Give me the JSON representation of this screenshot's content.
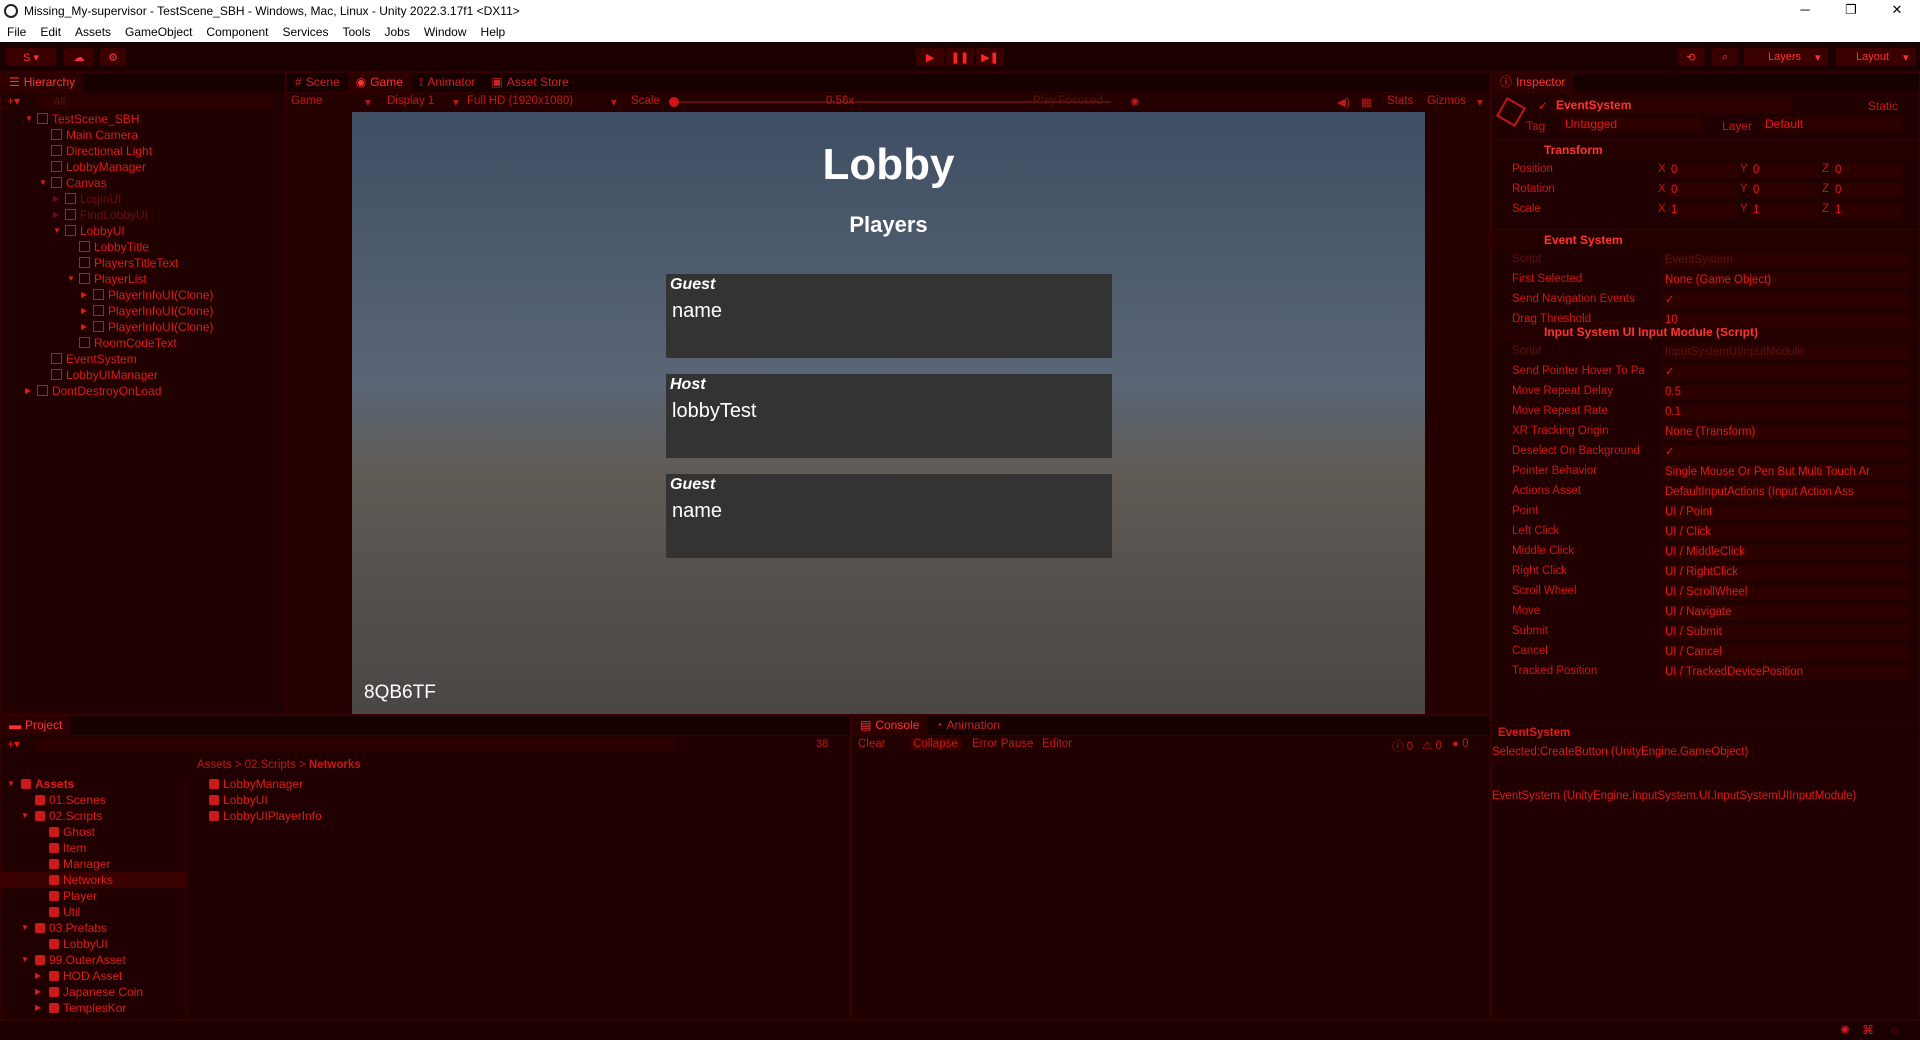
{
  "window": {
    "title": "Missing_My-supervisor - TestScene_SBH - Windows, Mac, Linux - Unity 2022.3.17f1 <DX11>",
    "controls": [
      "─",
      "❐",
      "✕"
    ]
  },
  "menu": [
    "File",
    "Edit",
    "Assets",
    "GameObject",
    "Component",
    "Services",
    "Tools",
    "Jobs",
    "Window",
    "Help"
  ],
  "toolbar": {
    "account_label": "S ▾",
    "layers_label": "Layers",
    "layout_label": "Layout"
  },
  "hierarchy": {
    "tab": "Hierarchy",
    "search_placeholder": "All",
    "items": [
      {
        "label": "TestScene_SBH",
        "indent": 0,
        "dim": false,
        "arrow": "▼"
      },
      {
        "label": "Main Camera",
        "indent": 1,
        "dim": false,
        "arrow": ""
      },
      {
        "label": "Directional Light",
        "indent": 1,
        "dim": false,
        "arrow": ""
      },
      {
        "label": "LobbyManager",
        "indent": 1,
        "dim": false,
        "arrow": ""
      },
      {
        "label": "Canvas",
        "indent": 1,
        "dim": false,
        "arrow": "▼"
      },
      {
        "label": "LoginUI",
        "indent": 2,
        "dim": true,
        "arrow": "▶"
      },
      {
        "label": "FindLobbyUI",
        "indent": 2,
        "dim": true,
        "arrow": "▶"
      },
      {
        "label": "LobbyUI",
        "indent": 2,
        "dim": false,
        "arrow": "▼"
      },
      {
        "label": "LobbyTitle",
        "indent": 3,
        "dim": false,
        "arrow": ""
      },
      {
        "label": "PlayersTitleText",
        "indent": 3,
        "dim": false,
        "arrow": ""
      },
      {
        "label": "PlayerList",
        "indent": 3,
        "dim": false,
        "arrow": "▼"
      },
      {
        "label": "PlayerInfoUI(Clone)",
        "indent": 4,
        "dim": false,
        "arrow": "▶"
      },
      {
        "label": "PlayerInfoUI(Clone)",
        "indent": 4,
        "dim": false,
        "arrow": "▶"
      },
      {
        "label": "PlayerInfoUI(Clone)",
        "indent": 4,
        "dim": false,
        "arrow": "▶"
      },
      {
        "label": "RoomCodeText",
        "indent": 3,
        "dim": false,
        "arrow": ""
      },
      {
        "label": "EventSystem",
        "indent": 1,
        "dim": false,
        "arrow": ""
      },
      {
        "label": "LobbyUIManager",
        "indent": 1,
        "dim": false,
        "arrow": ""
      },
      {
        "label": "DontDestroyOnLoad",
        "indent": 0,
        "dim": false,
        "arrow": "▶"
      }
    ]
  },
  "center_tabs": [
    "Scene",
    "Game",
    "Animator",
    "Asset Store"
  ],
  "game_toolbar": {
    "mode": "Game",
    "display": "Display 1",
    "resolution": "Full HD (1920x1080)",
    "scale_label": "Scale",
    "scale_value": "0.56x",
    "play_focused": "Play Focused",
    "stats": "Stats",
    "gizmos": "Gizmos"
  },
  "game": {
    "title": "Lobby",
    "subtitle": "Players",
    "players": [
      {
        "role": "Guest",
        "name": "name"
      },
      {
        "role": "Host",
        "name": "lobbyTest"
      },
      {
        "role": "Guest",
        "name": "name"
      }
    ],
    "room_code": "8QB6TF"
  },
  "inspector": {
    "tab": "Inspector",
    "object_name": "EventSystem",
    "static_label": "Static",
    "tag_label": "Tag",
    "tag_value": "Untagged",
    "layer_label": "Layer",
    "layer_value": "Default",
    "transform": {
      "header": "Transform",
      "rows": [
        {
          "label": "Position",
          "x": "0",
          "y": "0",
          "z": "0"
        },
        {
          "label": "Rotation",
          "x": "0",
          "y": "0",
          "z": "0"
        },
        {
          "label": "Scale",
          "x": "1",
          "y": "1",
          "z": "1"
        }
      ]
    },
    "event_system": {
      "header": "Event System",
      "rows": [
        {
          "label": "Script",
          "value": "EventSystem",
          "dim": true
        },
        {
          "label": "First Selected",
          "value": "None (Game Object)",
          "dim": false
        },
        {
          "label": "Send Navigation Events",
          "value": "✓",
          "dim": false
        },
        {
          "label": "Drag Threshold",
          "value": "10",
          "dim": false
        }
      ]
    },
    "input_module": {
      "header": "Input System UI Input Module (Script)",
      "rows": [
        {
          "label": "Script",
          "value": "InputSystemUIInputModule",
          "dim": true
        },
        {
          "label": "Send Pointer Hover To Pa",
          "value": "✓",
          "dim": false
        },
        {
          "label": "Move Repeat Delay",
          "value": "0.5",
          "dim": false
        },
        {
          "label": "Move Repeat Rate",
          "value": "0.1",
          "dim": false
        },
        {
          "label": "XR Tracking Origin",
          "value": "None (Transform)",
          "dim": false
        },
        {
          "label": "Deselect On Background",
          "value": "✓",
          "dim": false
        },
        {
          "label": "Pointer Behavior",
          "value": "Single Mouse Or Pen But Multi Touch Ar",
          "dim": false
        },
        {
          "label": "Actions Asset",
          "value": "DefaultInputActions (Input Action Ass",
          "dim": false
        },
        {
          "label": "Point",
          "value": "UI / Point",
          "dim": false
        },
        {
          "label": "Left Click",
          "value": "UI / Click",
          "dim": false
        },
        {
          "label": "Middle Click",
          "value": "UI / MiddleClick",
          "dim": false
        },
        {
          "label": "Right Click",
          "value": "UI / RightClick",
          "dim": false
        },
        {
          "label": "Scroll Wheel",
          "value": "UI / ScrollWheel",
          "dim": false
        },
        {
          "label": "Move",
          "value": "UI / Navigate",
          "dim": false
        },
        {
          "label": "Submit",
          "value": "UI / Submit",
          "dim": false
        },
        {
          "label": "Cancel",
          "value": "UI / Cancel",
          "dim": false
        },
        {
          "label": "Tracked Position",
          "value": "UI / TrackedDevicePosition",
          "dim": false
        }
      ]
    },
    "preview_label": "EventSystem"
  },
  "project": {
    "tab": "Project",
    "count": "38",
    "breadcrumb": [
      "Assets",
      "02.Scripts",
      "Networks"
    ],
    "tree": [
      {
        "label": "Assets",
        "indent": 0,
        "arrow": "▼",
        "bold": true
      },
      {
        "label": "01.Scenes",
        "indent": 1,
        "arrow": "",
        "bold": false
      },
      {
        "label": "02.Scripts",
        "indent": 1,
        "arrow": "▼",
        "bold": false
      },
      {
        "label": "Ghost",
        "indent": 2,
        "arrow": "",
        "bold": false
      },
      {
        "label": "Item",
        "indent": 2,
        "arrow": "",
        "bold": false
      },
      {
        "label": "Manager",
        "indent": 2,
        "arrow": "",
        "bold": false
      },
      {
        "label": "Networks",
        "indent": 2,
        "arrow": "",
        "bold": false
      },
      {
        "label": "Player",
        "indent": 2,
        "arrow": "",
        "bold": false
      },
      {
        "label": "Util",
        "indent": 2,
        "arrow": "",
        "bold": false
      },
      {
        "label": "03.Prefabs",
        "indent": 1,
        "arrow": "▼",
        "bold": false
      },
      {
        "label": "LobbyUI",
        "indent": 2,
        "arrow": "",
        "bold": false
      },
      {
        "label": "99.OuterAsset",
        "indent": 1,
        "arrow": "▼",
        "bold": false
      },
      {
        "label": "HOD Asset",
        "indent": 2,
        "arrow": "▶",
        "bold": false
      },
      {
        "label": "Japanese Coin",
        "indent": 2,
        "arrow": "▶",
        "bold": false
      },
      {
        "label": "TemplesKor",
        "indent": 2,
        "arrow": "▶",
        "bold": false
      }
    ],
    "files": [
      "LobbyManager",
      "LobbyUI",
      "LobbyUIPlayerInfo"
    ]
  },
  "console": {
    "tabs": [
      "Console",
      "Animation"
    ],
    "buttons": [
      "Clear",
      "Collapse",
      "Error Pause",
      "Editor"
    ],
    "counts": [
      "0",
      "0",
      "0"
    ],
    "messages": [
      "Selected:CreateButton (UnityEngine.GameObject)",
      "EventSystem (UnityEngine.InputSystem.UI.InputSystemUIInputModule)"
    ]
  }
}
